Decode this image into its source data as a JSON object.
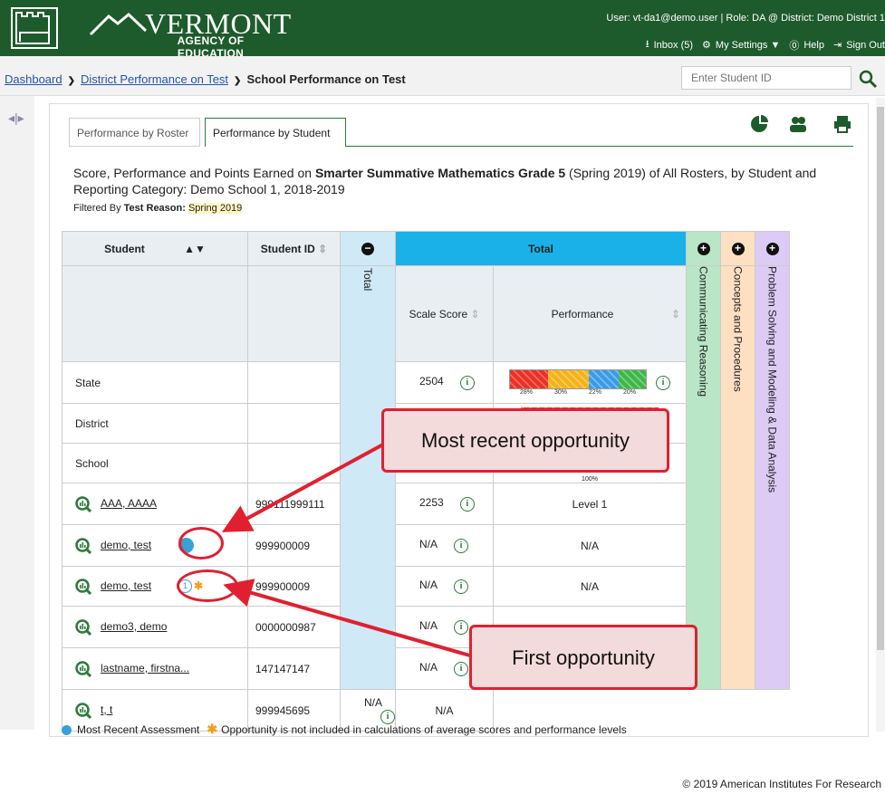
{
  "header": {
    "logo_title": "VERMONT",
    "logo_sub": "AGENCY OF EDUCATION",
    "user_info": "User: vt-da1@demo.user  |  Role: DA @ District: Demo District 1",
    "inbox": "Inbox (5)",
    "settings": "My Settings ▼",
    "help": "Help",
    "signout": "Sign Out"
  },
  "breadcrumb": {
    "items": [
      "Dashboard",
      "District Performance on Test"
    ],
    "current": "School Performance on Test"
  },
  "search": {
    "placeholder": "Enter Student ID"
  },
  "tabs": [
    "Performance by Roster",
    "Performance by Student"
  ],
  "description": {
    "part1": "Score, Performance and Points Earned on ",
    "test": "Smarter Summative Mathematics Grade 5",
    "part2": " (Spring 2019) of All Rosters, by Student and Reporting Category: Demo School 1, 2018-2019",
    "filter_label": "Filtered By ",
    "filter_key": "Test Reason:",
    "filter_value": "Spring 2019"
  },
  "table": {
    "headers": {
      "student": "Student",
      "student_id": "Student ID",
      "total": "Total",
      "total_band": "Total",
      "scale_score": "Scale Score",
      "performance": "Performance",
      "cat1": "Communicating Reasoning",
      "cat2": "Concepts and Procedures",
      "cat3": "Problem Solving and Modeling & Data Analysis"
    },
    "aggregate_rows": [
      {
        "label": "State",
        "scale_score": "2504",
        "pct": [
          "28%",
          "30%",
          "22%",
          "20%"
        ]
      },
      {
        "label": "District",
        "scale_score": "",
        "pct": []
      },
      {
        "label": "School",
        "scale_score": "",
        "pct_note": "100%"
      }
    ],
    "student_rows": [
      {
        "name": "AAA, AAAA",
        "id": "999111999111",
        "scale_score": "2253",
        "performance": "Level 1",
        "badge": ""
      },
      {
        "name": "demo, test",
        "id": "999900009",
        "scale_score": "N/A",
        "performance": "N/A",
        "badge": "recent"
      },
      {
        "name": "demo, test",
        "id": "999900009",
        "scale_score": "N/A",
        "performance": "N/A",
        "badge": "first",
        "badge_text": "1"
      },
      {
        "name": "demo3, demo",
        "id": "0000000987",
        "scale_score": "N/A",
        "performance": "",
        "badge": ""
      },
      {
        "name": "lastname, firstna...",
        "id": "147147147",
        "scale_score": "N/A",
        "performance": "",
        "badge": ""
      },
      {
        "name": "t, t",
        "id": "999945695",
        "scale_score": "N/A",
        "performance": "N/A",
        "badge": ""
      }
    ]
  },
  "legend": {
    "recent": "Most Recent Assessment",
    "excluded": "Opportunity is not included in calculations of average scores and performance levels"
  },
  "annotations": {
    "recent": "Most recent opportunity",
    "first": "First opportunity"
  },
  "footer": {
    "copyright": "© 2019 American Institutes For Research"
  },
  "colors": {
    "header_green": "#1e5b2c",
    "total_blue": "#1ab0e8",
    "cat1": "#b8e6c6",
    "cat2": "#fde0c2",
    "cat3": "#dccbf5",
    "level1": "#e8322a",
    "level2": "#f6b21c",
    "level3": "#3a9be8",
    "level4": "#3fb64a",
    "callout_border": "#e02030"
  }
}
